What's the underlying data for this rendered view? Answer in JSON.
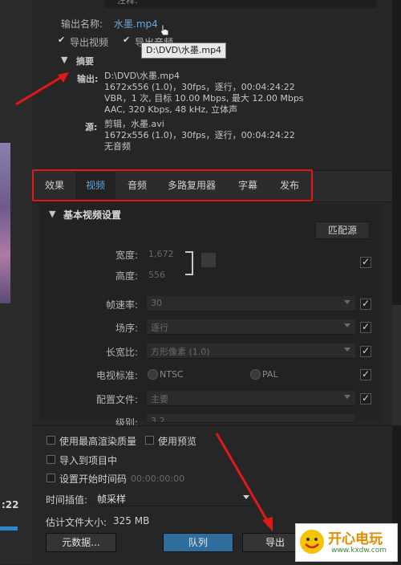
{
  "top": {
    "note_label": "注释:",
    "output_name_label": "输出名称:",
    "output_name_value": "水墨.mp4",
    "export_video_label": "导出视频",
    "export_audio_label": "导出音频",
    "tooltip": "D:\\DVD\\水墨.mp4"
  },
  "summary": {
    "title": "摘要",
    "output_label": "输出:",
    "output_lines": [
      "D:\\DVD\\水墨.mp4",
      "1672x556 (1.0)，30fps，逐行，00:04:24:22",
      "VBR，1 次, 目标 10.00 Mbps, 最大 12.00 Mbps",
      "AAC, 320 Kbps, 48  kHz, 立体声"
    ],
    "source_label": "源:",
    "source_lines": [
      "剪辑，水墨.avi",
      "1672x556 (1.0)，30fps，逐行，00:04:24:22",
      "无音频"
    ]
  },
  "tabs": [
    "效果",
    "视频",
    "音频",
    "多路复用器",
    "字幕",
    "发布"
  ],
  "video": {
    "section_title": "基本视频设置",
    "match_source": "匹配源",
    "width_label": "宽度:",
    "width_value": "1,672",
    "height_label": "高度:",
    "height_value": "556",
    "framerate_label": "帧速率:",
    "framerate_value": "30",
    "field_order_label": "场序:",
    "field_order_value": "逐行",
    "aspect_label": "长宽比:",
    "aspect_value": "方形像素 (1.0)",
    "tv_standard_label": "电视标准:",
    "ntsc": "NTSC",
    "pal": "PAL",
    "profile_label": "配置文件:",
    "profile_value": "主要",
    "level_label": "级别:",
    "level_value": "3.2"
  },
  "bottom": {
    "max_render_quality": "使用最高渲染质量",
    "use_previews": "使用预览",
    "import_into_project": "导入到项目中",
    "set_start_timecode": "设置开始时间码",
    "start_timecode_value": "00:00:00:00",
    "time_interpolation_label": "时间插值:",
    "time_interpolation_value": "帧采样",
    "estimated_size_label": "估计文件大小:",
    "estimated_size_value": "325 MB",
    "metadata_button": "元数据...",
    "queue_button": "队列",
    "export_button": "导出"
  },
  "left": {
    "time": ":22"
  },
  "logo": {
    "name": "开心电玩",
    "url": "www.kxdw.com"
  },
  "colors": {
    "accent": "#2f6d9c",
    "annotation_red": "#e01818",
    "link_blue": "#6ea6d6"
  }
}
